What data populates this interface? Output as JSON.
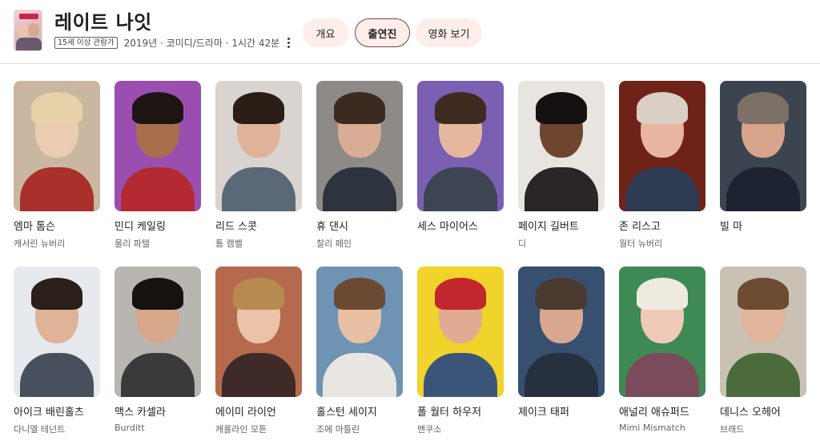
{
  "movie": {
    "title": "레이트 나잇",
    "rating": "15세 이상 관람가",
    "meta": "2019년 · 코미디/드라마 · 1시간 42분"
  },
  "tabs": [
    {
      "label": "개요",
      "active": false
    },
    {
      "label": "출연진",
      "active": true
    },
    {
      "label": "영화 보기",
      "active": false
    }
  ],
  "cast": [
    {
      "name": "엠마 톰슨",
      "role": "캐서린 뉴버리",
      "colors": {
        "bg": "#c9b7a1",
        "skin": "#eccbb3",
        "hair": "#e6d1a8",
        "cloth": "#a9302b"
      }
    },
    {
      "name": "민디 케일링",
      "role": "몰리 파텔",
      "colors": {
        "bg": "#9a4fb0",
        "skin": "#a86f4d",
        "hair": "#1e1512",
        "cloth": "#b32a32"
      }
    },
    {
      "name": "리드 스콧",
      "role": "톰 캠벨",
      "colors": {
        "bg": "#d9d4cf",
        "skin": "#dfb39a",
        "hair": "#2a1d16",
        "cloth": "#5a6878"
      }
    },
    {
      "name": "휴 댄시",
      "role": "찰리 페인",
      "colors": {
        "bg": "#8e8a86",
        "skin": "#d9ad95",
        "hair": "#3b2a1f",
        "cloth": "#2e343d"
      }
    },
    {
      "name": "세스 마이어스",
      "role": "",
      "colors": {
        "bg": "#7a5fb3",
        "skin": "#e6b79f",
        "hair": "#3e2a1e",
        "cloth": "#3d4552"
      }
    },
    {
      "name": "페이지 길버트",
      "role": "디",
      "colors": {
        "bg": "#e8e4e0",
        "skin": "#6e4530",
        "hair": "#151110",
        "cloth": "#2a2526"
      }
    },
    {
      "name": "존 리스고",
      "role": "월터 뉴버리",
      "colors": {
        "bg": "#6f2218",
        "skin": "#e7b5a0",
        "hair": "#d9cfc4",
        "cloth": "#2d3a52"
      }
    },
    {
      "name": "빌 마",
      "role": "",
      "colors": {
        "bg": "#3c4450",
        "skin": "#d8a48c",
        "hair": "#7d7067",
        "cloth": "#1c2230"
      }
    },
    {
      "name": "아이크 배린홀츠",
      "role": "다니엘 테넌트",
      "colors": {
        "bg": "#e6e9ee",
        "skin": "#e0b398",
        "hair": "#2a1f19",
        "cloth": "#48505e"
      }
    },
    {
      "name": "맥스 카셀라",
      "role": "Burditt",
      "colors": {
        "bg": "#b9b6b1",
        "skin": "#d7a78c",
        "hair": "#17110f",
        "cloth": "#3a3a3c"
      }
    },
    {
      "name": "에이미 라이언",
      "role": "캐롤라인 모튼",
      "colors": {
        "bg": "#b56a4d",
        "skin": "#eac3a8",
        "hair": "#b78b4f",
        "cloth": "#3e2a26"
      }
    },
    {
      "name": "홀스턴 세이지",
      "role": "조에 마틀린",
      "colors": {
        "bg": "#6f93b3",
        "skin": "#e8c0a4",
        "hair": "#6b4a34",
        "cloth": "#e9e6e2"
      }
    },
    {
      "name": "폴 월터 하우저",
      "role": "맨쿠소",
      "colors": {
        "bg": "#f0d32b",
        "skin": "#e0ab92",
        "hair": "#c1272d",
        "cloth": "#3b5579"
      }
    },
    {
      "name": "제이크 태퍼",
      "role": "",
      "colors": {
        "bg": "#37506f",
        "skin": "#d9a88e",
        "hair": "#4a3a30",
        "cloth": "#27303e"
      }
    },
    {
      "name": "애널리 애슈퍼드",
      "role": "Mimi Mismatch",
      "colors": {
        "bg": "#3f8a54",
        "skin": "#efcab8",
        "hair": "#efeae0",
        "cloth": "#7a4b5a"
      }
    },
    {
      "name": "데니스 오헤어",
      "role": "브래드",
      "colors": {
        "bg": "#c9c1b3",
        "skin": "#e1b59b",
        "hair": "#6e4b33",
        "cloth": "#4c6b3c"
      }
    }
  ]
}
